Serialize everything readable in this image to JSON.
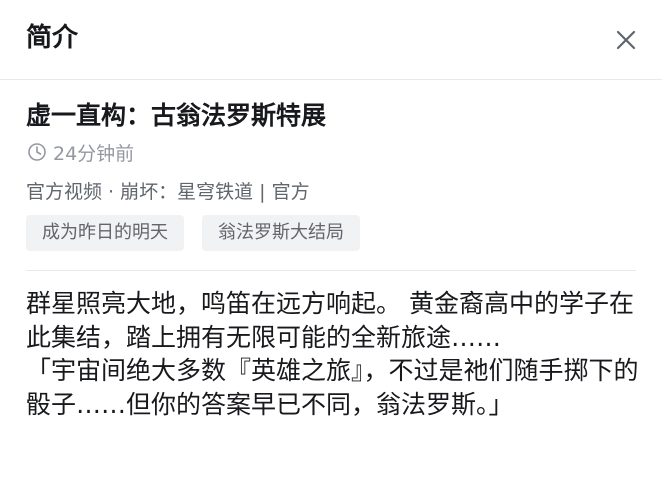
{
  "header": {
    "title": "简介"
  },
  "icons": {
    "close": "close-icon",
    "clock": "clock-icon"
  },
  "video": {
    "title": "虚一直构：古翁法罗斯特展",
    "time_ago": "24分钟前",
    "category": "官方视频 · 崩坏：星穹铁道 | 官方",
    "tags": [
      "成为昨日的明天",
      "翁法罗斯大结局"
    ],
    "description": "群星照亮大地，鸣笛在远方响起。 黄金裔高中的学子在此集结，踏上拥有无限可能的全新旅途……\n「宇宙间绝大多数『英雄之旅』，不过是祂们随手掷下的骰子……但你的答案早已不同，翁法罗斯。」"
  },
  "colors": {
    "text": "#18191c",
    "secondary": "#61666d",
    "muted": "#9499a0",
    "tag_bg": "#f1f2f3",
    "divider": "#e8e9eb"
  }
}
